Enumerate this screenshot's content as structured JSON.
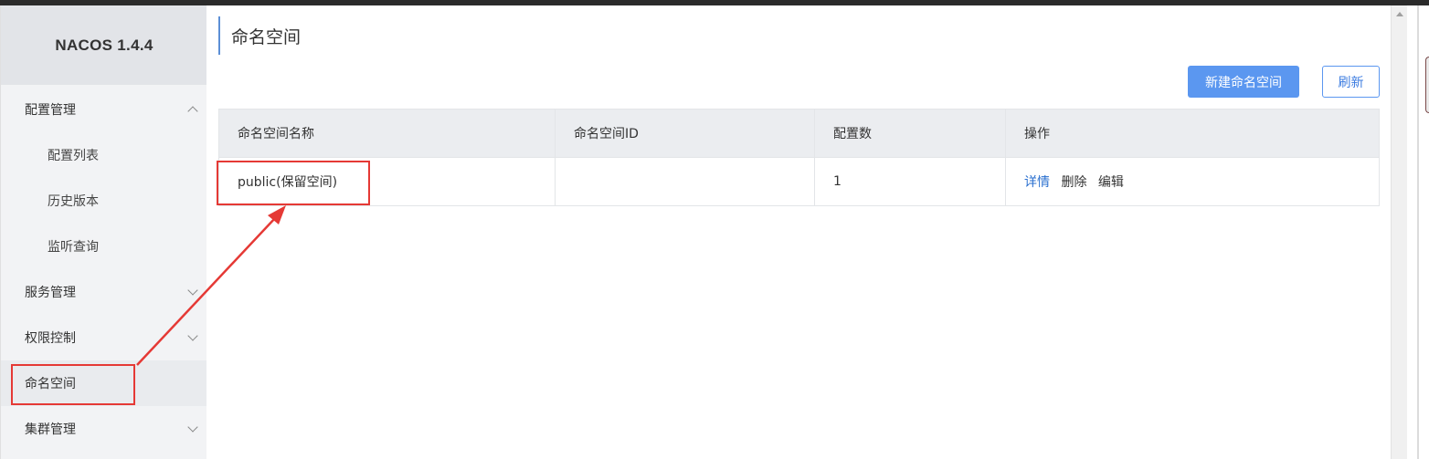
{
  "app": {
    "brand": "NACOS 1.4.4"
  },
  "sidebar": {
    "items": [
      {
        "label": "配置管理",
        "level": 1,
        "expanded": true
      },
      {
        "label": "配置列表",
        "level": 2
      },
      {
        "label": "历史版本",
        "level": 2
      },
      {
        "label": "监听查询",
        "level": 2
      },
      {
        "label": "服务管理",
        "level": 1,
        "expanded": false
      },
      {
        "label": "权限控制",
        "level": 1,
        "expanded": false
      },
      {
        "label": "命名空间",
        "level": 1,
        "active": true
      },
      {
        "label": "集群管理",
        "level": 1,
        "expanded": false
      }
    ]
  },
  "page": {
    "title": "命名空间",
    "buttons": {
      "create": "新建命名空间",
      "refresh": "刷新"
    }
  },
  "table": {
    "columns": [
      "命名空间名称",
      "命名空间ID",
      "配置数",
      "操作"
    ],
    "rows": [
      {
        "name": "public(保留空间)",
        "id": "",
        "config_count": "1",
        "actions": {
          "detail": "详情",
          "delete": "删除",
          "edit": "编辑"
        }
      }
    ]
  },
  "colors": {
    "accent": "#5b97f0",
    "link": "#2a6fcf",
    "annotation": "#e53935"
  }
}
